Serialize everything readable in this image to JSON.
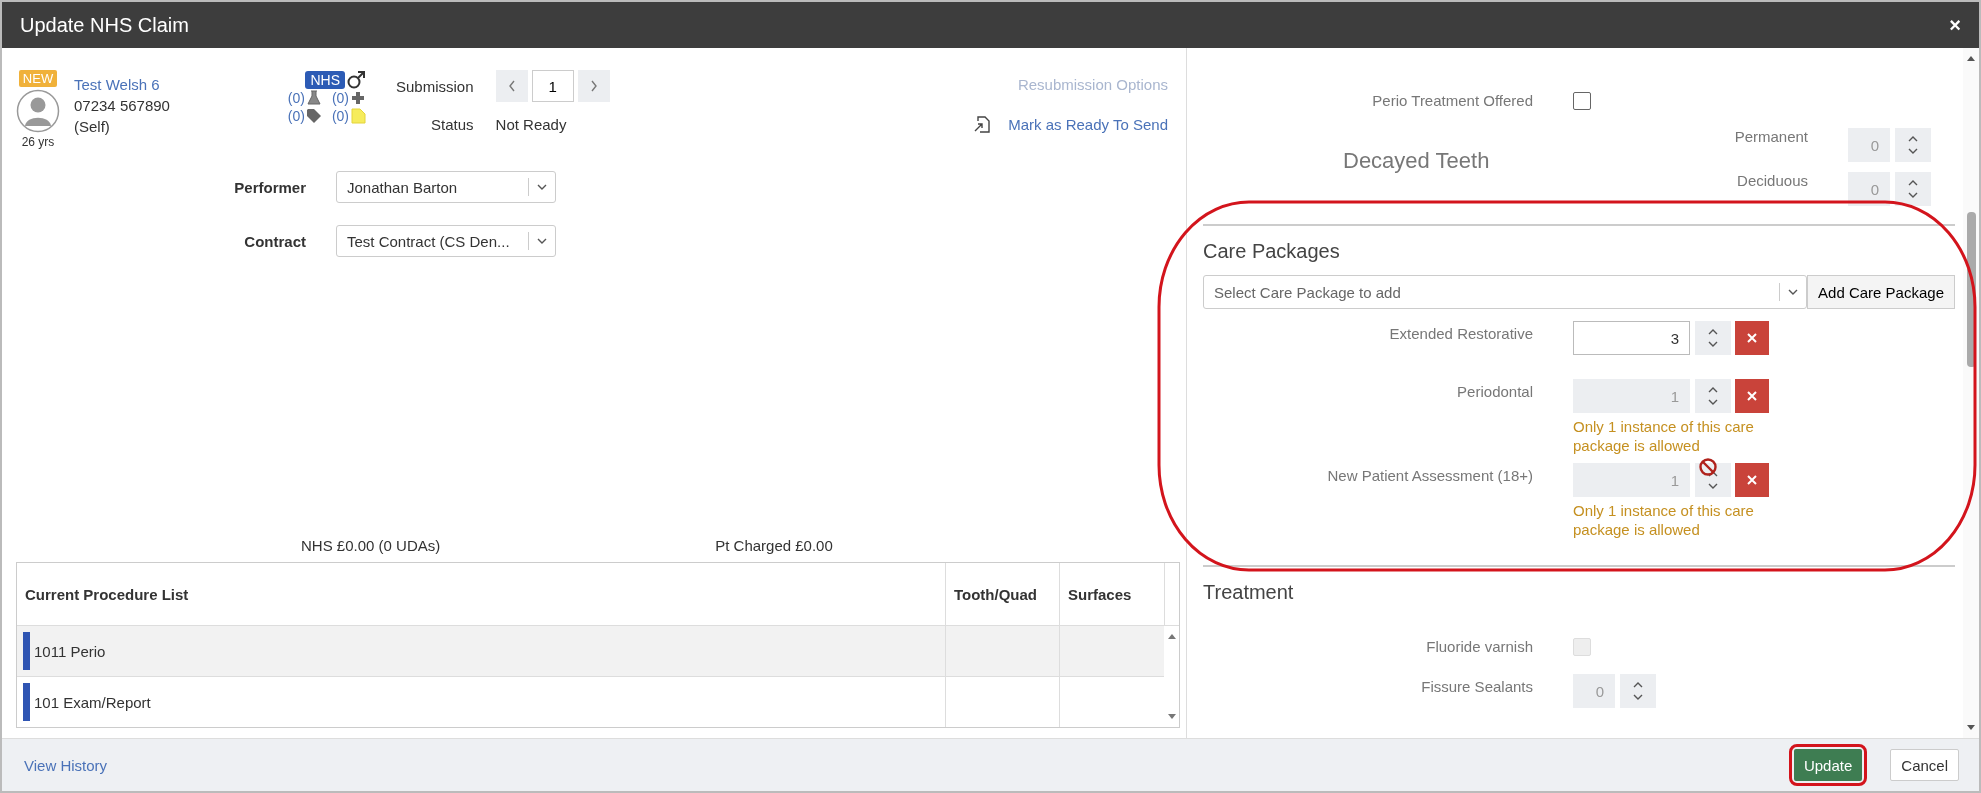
{
  "window": {
    "title": "Update NHS Claim",
    "close": "×"
  },
  "patient": {
    "badge": "NEW",
    "name": "Test Welsh 6",
    "phone": "07234 567890",
    "relation": "(Self)",
    "age": "26 yrs",
    "scheme": "NHS",
    "counters": [
      {
        "kind": "lab",
        "count": "(0)"
      },
      {
        "kind": "medical",
        "count": "(0)"
      },
      {
        "kind": "tag",
        "count": "(0)"
      },
      {
        "kind": "note",
        "count": "(0)"
      }
    ]
  },
  "submission": {
    "label": "Submission",
    "value": "1",
    "status_label": "Status",
    "status": "Not Ready"
  },
  "links": [
    {
      "label": "Resubmission Options",
      "disabled": true,
      "kind": "plain"
    },
    {
      "label": "Mark as Ready To Send",
      "disabled": false,
      "kind": "document"
    }
  ],
  "fields": [
    {
      "label": "Performer",
      "value": "Jonathan Barton"
    },
    {
      "label": "Contract",
      "value": "Test Contract (CS Den..."
    }
  ],
  "totals": [
    "NHS £0.00 (0 UDAs)",
    "Pt Charged £0.00"
  ],
  "procedures": {
    "columns": [
      "Current Procedure List",
      "Tooth/Quad",
      "Surfaces"
    ],
    "rows": [
      {
        "name": "1011 Perio",
        "selected": true
      },
      {
        "name": "101 Exam/Report",
        "selected": false
      }
    ]
  },
  "checks": [
    {
      "label": "Perio Treatment Offered",
      "checked": false
    }
  ],
  "decayed": {
    "title": "Decayed Teeth",
    "counts": [
      {
        "label": "Permanent",
        "value": "0"
      },
      {
        "label": "Deciduous",
        "value": "0"
      }
    ]
  },
  "care_packages": {
    "title": "Care Packages",
    "placeholder": "Select Care Package to add",
    "add_button": "Add Care Package",
    "items": [
      {
        "name": "Extended Restorative",
        "value": "3",
        "disabled": false,
        "blocked": false
      },
      {
        "name": "Periodontal",
        "value": "1",
        "disabled": true,
        "blocked": false,
        "message": "Only 1 instance of this care package is allowed"
      },
      {
        "name": "New Patient Assessment (18+)",
        "value": "1",
        "disabled": true,
        "blocked": true,
        "message": "Only 1 instance of this care package is allowed"
      }
    ]
  },
  "treatment": {
    "title": "Treatment",
    "items": [
      {
        "kind": "checkbox",
        "label": "Fluoride varnish",
        "checked": false
      },
      {
        "kind": "spinner",
        "label": "Fissure Sealants",
        "value": "0"
      }
    ]
  },
  "footer": {
    "history": "View History",
    "buttons": [
      {
        "label": "Update",
        "kind": "primary",
        "highlighted": true
      },
      {
        "label": "Cancel",
        "kind": "default",
        "highlighted": false
      }
    ]
  },
  "annotations": [
    {
      "kind": "ellipse"
    }
  ]
}
